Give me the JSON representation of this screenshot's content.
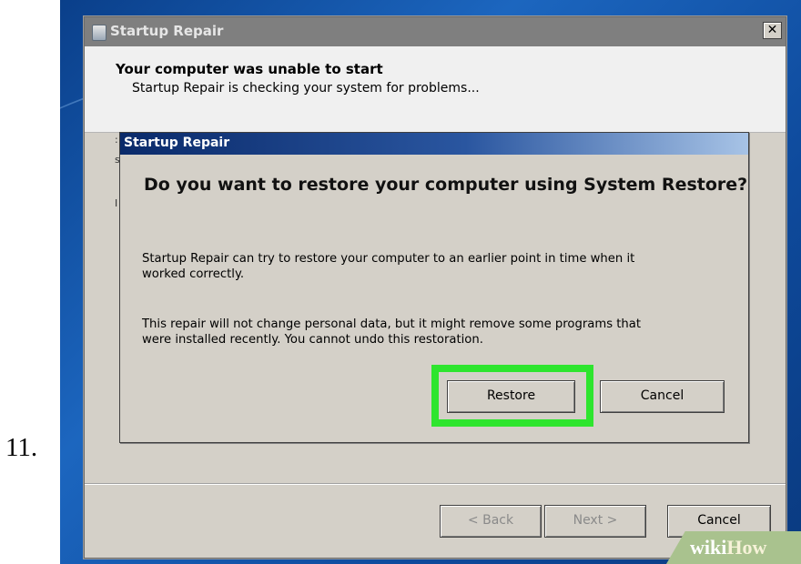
{
  "step_number": "11.",
  "outer_window": {
    "title": "Startup Repair",
    "close_glyph": "✕",
    "heading": "Your computer was unable to start",
    "subheading": "Startup Repair is checking your system for problems...",
    "left_fragments": [
      ":",
      "s",
      "I"
    ],
    "buttons": {
      "back": "< Back",
      "next": "Next >",
      "cancel": "Cancel"
    }
  },
  "dialog": {
    "title": "Startup Repair",
    "question": "Do you want to restore your computer using System Restore?",
    "paragraph1_line1": "Startup Repair can try to restore your computer to an earlier point in time when it",
    "paragraph1_line2": "worked correctly.",
    "paragraph2_line1": "This repair will not change personal data, but it might remove some programs that",
    "paragraph2_line2": "were installed recently. You cannot undo this restoration.",
    "buttons": {
      "restore": "Restore",
      "cancel": "Cancel"
    }
  },
  "watermark": {
    "wiki": "wiki",
    "how": "How"
  },
  "colors": {
    "highlight": "#2ee52e",
    "desktop": "#1c66bf",
    "dialog_title": "#0a2a6a"
  },
  "icons": [
    "startup-repair-app-icon",
    "close-icon"
  ]
}
